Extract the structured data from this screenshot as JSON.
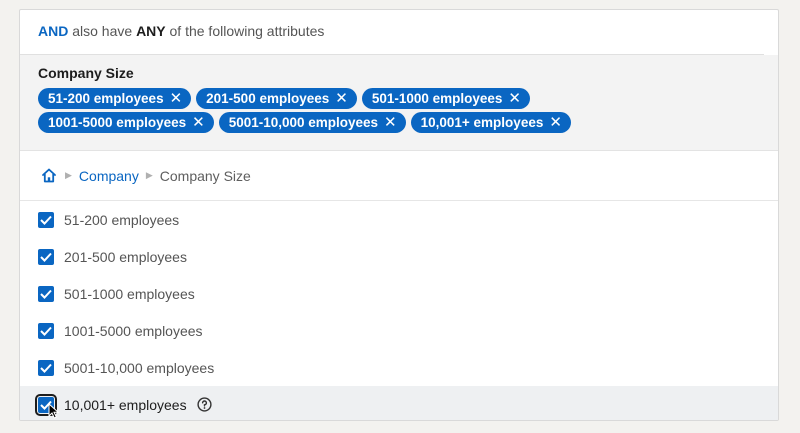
{
  "header": {
    "and_keyword": "AND",
    "middle_text": " also have ",
    "any_keyword": "ANY",
    "tail_text": " of the following attributes"
  },
  "selected": {
    "title": "Company Size",
    "chips": [
      {
        "label": "51-200 employees"
      },
      {
        "label": "201-500 employees"
      },
      {
        "label": "501-1000 employees"
      },
      {
        "label": "1001-5000 employees"
      },
      {
        "label": "5001-10,000 employees"
      },
      {
        "label": "10,001+ employees"
      }
    ],
    "remove_glyph": "✕"
  },
  "breadcrumb": {
    "home_icon": "home-icon",
    "items": [
      "Company",
      "Company Size"
    ]
  },
  "options": [
    {
      "label": "51-200 employees",
      "checked": true
    },
    {
      "label": "201-500 employees",
      "checked": true
    },
    {
      "label": "501-1000 employees",
      "checked": true
    },
    {
      "label": "1001-5000 employees",
      "checked": true
    },
    {
      "label": "5001-10,000 employees",
      "checked": true
    },
    {
      "label": "10,001+ employees",
      "checked": true
    }
  ],
  "colors": {
    "accent": "#0a66c2"
  }
}
